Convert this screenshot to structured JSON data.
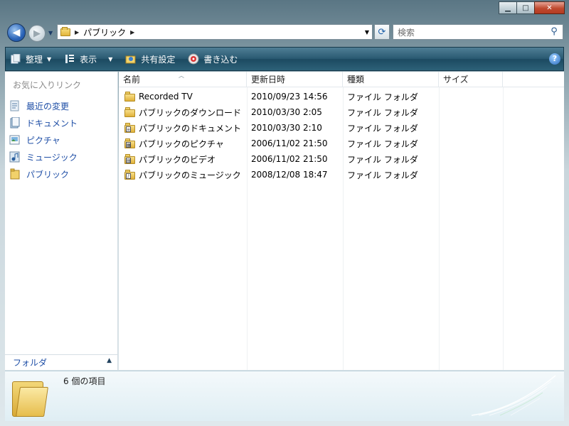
{
  "window": {
    "caption_buttons": {
      "minimize": "▁",
      "maximize": "□",
      "close": "✕"
    }
  },
  "nav": {
    "back_icon": "arrow-left-icon",
    "forward_icon": "arrow-right-icon",
    "address_segments": [
      "パブリック"
    ],
    "refresh_icon": "refresh-icon",
    "search_placeholder": "検索"
  },
  "toolbar": {
    "organize_label": "整理",
    "views_label": "表示",
    "share_label": "共有設定",
    "burn_label": "書き込む"
  },
  "sidebar": {
    "title": "お気に入りリンク",
    "items": [
      {
        "label": "最近の変更",
        "icon": "recent-icon"
      },
      {
        "label": "ドキュメント",
        "icon": "documents-icon"
      },
      {
        "label": "ピクチャ",
        "icon": "pictures-icon"
      },
      {
        "label": "ミュージック",
        "icon": "music-icon"
      },
      {
        "label": "パブリック",
        "icon": "folder-icon"
      }
    ],
    "folders_label": "フォルダ"
  },
  "filelist": {
    "columns": [
      "名前",
      "更新日時",
      "種類",
      "サイズ"
    ],
    "rows": [
      {
        "name": "Recorded TV",
        "date": "2010/09/23 14:56",
        "type": "ファイル フォルダ",
        "size": "",
        "overlay": ""
      },
      {
        "name": "パブリックのダウンロード",
        "date": "2010/03/30 2:05",
        "type": "ファイル フォルダ",
        "size": "",
        "overlay": ""
      },
      {
        "name": "パブリックのドキュメント",
        "date": "2010/03/30 2:10",
        "type": "ファイル フォルダ",
        "size": "",
        "overlay": "doc"
      },
      {
        "name": "パブリックのピクチャ",
        "date": "2006/11/02 21:50",
        "type": "ファイル フォルダ",
        "size": "",
        "overlay": "pic"
      },
      {
        "name": "パブリックのビデオ",
        "date": "2006/11/02 21:50",
        "type": "ファイル フォルダ",
        "size": "",
        "overlay": "vid"
      },
      {
        "name": "パブリックのミュージック",
        "date": "2008/12/08 18:47",
        "type": "ファイル フォルダ",
        "size": "",
        "overlay": "mus"
      }
    ]
  },
  "details": {
    "item_count": "6 個の項目"
  },
  "colors": {
    "accent": "#1e4ea6",
    "cmdbar": "#2a5a72"
  }
}
